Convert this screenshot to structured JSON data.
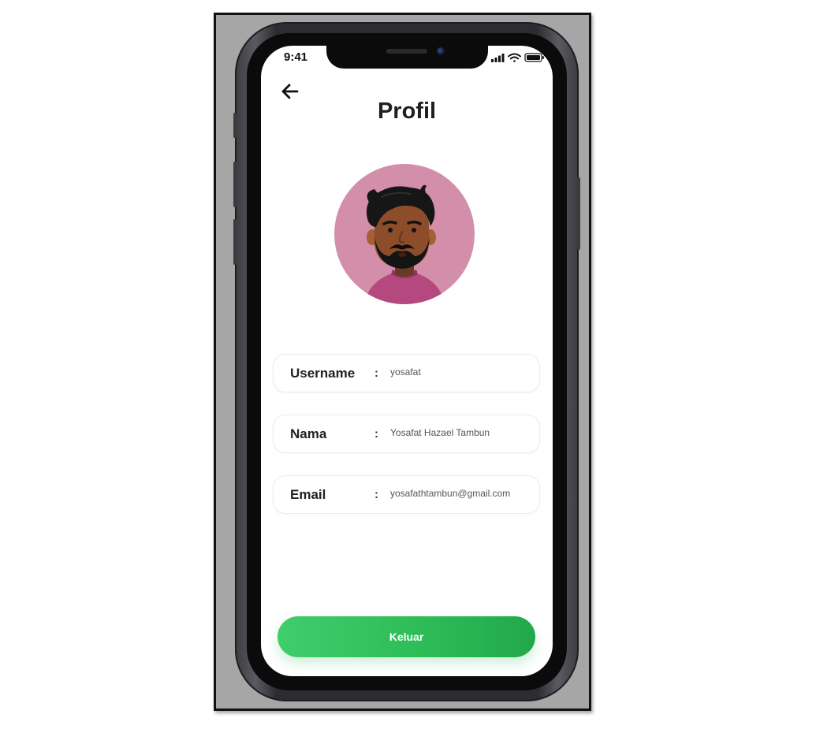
{
  "status_bar": {
    "time": "9:41"
  },
  "header": {
    "title": "Profil",
    "back_icon": "arrow-left-icon"
  },
  "profile": {
    "avatar_icon": "user-avatar",
    "avatar_bg": "#d38fa9"
  },
  "fields": [
    {
      "label": "Username",
      "separator": ":",
      "value": "yosafat"
    },
    {
      "label": "Nama",
      "separator": ":",
      "value": "Yosafat Hazael Tambun"
    },
    {
      "label": "Email",
      "separator": ":",
      "value": "yosafathtambun@gmail.com"
    }
  ],
  "actions": {
    "logout_label": "Keluar",
    "logout_color": "#2ebc58"
  }
}
